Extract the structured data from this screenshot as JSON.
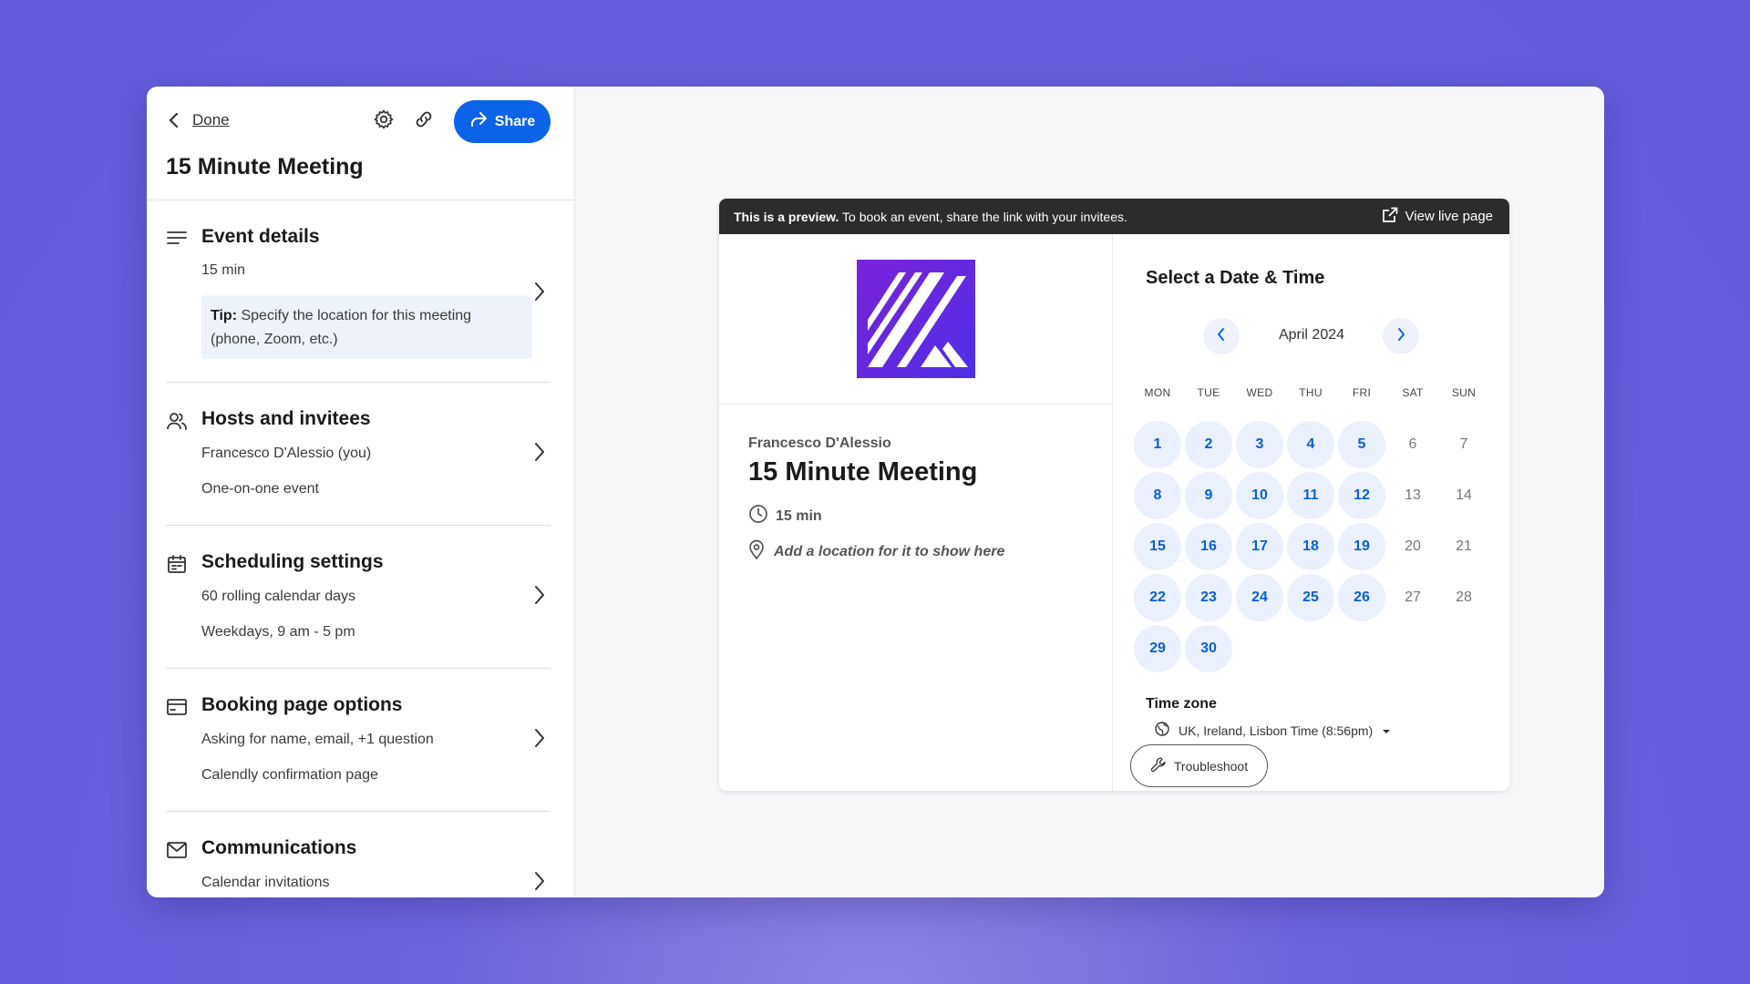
{
  "header": {
    "done_label": "Done",
    "share_label": "Share",
    "title": "15 Minute Meeting"
  },
  "sections": [
    {
      "title": "Event details",
      "icon": "lines-icon",
      "lines": [
        "15 min"
      ],
      "tip_label": "Tip:",
      "tip_text": "Specify the location for this meeting (phone, Zoom, etc.)"
    },
    {
      "title": "Hosts and invitees",
      "icon": "people-icon",
      "lines": [
        "Francesco D'Alessio (you)",
        "One-on-one event"
      ]
    },
    {
      "title": "Scheduling settings",
      "icon": "calendar-icon",
      "lines": [
        "60 rolling calendar days",
        "Weekdays, 9 am - 5 pm"
      ]
    },
    {
      "title": "Booking page options",
      "icon": "card-icon",
      "lines": [
        "Asking for name, email, +1 question",
        "Calendly confirmation page"
      ]
    },
    {
      "title": "Communications",
      "icon": "mail-icon",
      "lines": [
        "Calendar invitations"
      ]
    }
  ],
  "preview": {
    "bar_bold": "This is a preview.",
    "bar_text": " To book an event, share the link with your invitees.",
    "view_live": "View live page",
    "host": "Francesco D'Alessio",
    "meeting_title": "15 Minute Meeting",
    "duration": "15 min",
    "location_hint": "Add a location for it to show here",
    "logo_color": "#6a2be2"
  },
  "calendar": {
    "title": "Select a Date & Time",
    "month": "April 2024",
    "weekdays": [
      "MON",
      "TUE",
      "WED",
      "THU",
      "FRI",
      "SAT",
      "SUN"
    ],
    "weeks": [
      [
        {
          "d": "1",
          "a": true
        },
        {
          "d": "2",
          "a": true
        },
        {
          "d": "3",
          "a": true
        },
        {
          "d": "4",
          "a": true
        },
        {
          "d": "5",
          "a": true
        },
        {
          "d": "6",
          "a": false
        },
        {
          "d": "7",
          "a": false
        }
      ],
      [
        {
          "d": "8",
          "a": true
        },
        {
          "d": "9",
          "a": true
        },
        {
          "d": "10",
          "a": true
        },
        {
          "d": "11",
          "a": true
        },
        {
          "d": "12",
          "a": true
        },
        {
          "d": "13",
          "a": false
        },
        {
          "d": "14",
          "a": false
        }
      ],
      [
        {
          "d": "15",
          "a": true
        },
        {
          "d": "16",
          "a": true
        },
        {
          "d": "17",
          "a": true
        },
        {
          "d": "18",
          "a": true
        },
        {
          "d": "19",
          "a": true
        },
        {
          "d": "20",
          "a": false
        },
        {
          "d": "21",
          "a": false
        }
      ],
      [
        {
          "d": "22",
          "a": true
        },
        {
          "d": "23",
          "a": true
        },
        {
          "d": "24",
          "a": true
        },
        {
          "d": "25",
          "a": true
        },
        {
          "d": "26",
          "a": true
        },
        {
          "d": "27",
          "a": false
        },
        {
          "d": "28",
          "a": false
        }
      ],
      [
        {
          "d": "29",
          "a": true
        },
        {
          "d": "30",
          "a": true
        }
      ]
    ],
    "timezone_label": "Time zone",
    "timezone_value": "UK, Ireland, Lisbon Time (8:56pm)",
    "troubleshoot": "Troubleshoot",
    "accent": "#0b64e8"
  }
}
